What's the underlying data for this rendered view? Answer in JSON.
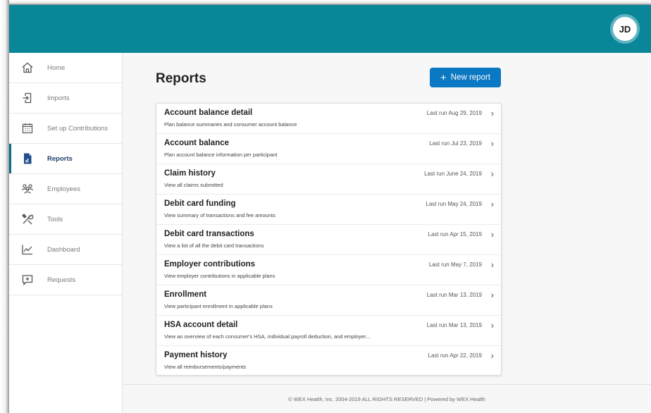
{
  "user": {
    "initials": "JD"
  },
  "sidebar": {
    "items": [
      {
        "label": "Home",
        "icon": "home-icon",
        "active": false
      },
      {
        "label": "Imports",
        "icon": "import-icon",
        "active": false
      },
      {
        "label": "Set up Contributions",
        "icon": "calendar-icon",
        "active": false
      },
      {
        "label": "Reports",
        "icon": "report-icon",
        "active": true
      },
      {
        "label": "Employees",
        "icon": "people-icon",
        "active": false
      },
      {
        "label": "Tools",
        "icon": "tools-icon",
        "active": false
      },
      {
        "label": "Dashboard",
        "icon": "chart-icon",
        "active": false
      },
      {
        "label": "Requests",
        "icon": "request-icon",
        "active": false
      }
    ]
  },
  "main": {
    "title": "Reports",
    "new_button": {
      "label": "New report",
      "icon": "plus-icon"
    }
  },
  "reports": [
    {
      "title": "Account balance detail",
      "desc": "Plan balance summaries and consumer account balance",
      "last_run": "Last run Aug 29, 2019"
    },
    {
      "title": "Account balance",
      "desc": "Plan account balance information per participant",
      "last_run": "Last run Jul 23, 2019"
    },
    {
      "title": "Claim history",
      "desc": "View all claims submitted",
      "last_run": "Last run June 24, 2019"
    },
    {
      "title": "Debit card funding",
      "desc": "View summary of transactions and fee amounts",
      "last_run": "Last run May 24, 2019"
    },
    {
      "title": "Debit card transactions",
      "desc": "View a list of all the debit card transactions",
      "last_run": "Last run Apr 15, 2019"
    },
    {
      "title": "Employer contributions",
      "desc": "View employer contributions in applicable plans",
      "last_run": "Last run May 7, 2019"
    },
    {
      "title": "Enrollment",
      "desc": "View participant enrollment in applicable plans",
      "last_run": "Last run Mar 13, 2019"
    },
    {
      "title": "HSA account detail",
      "desc": "View an overview of each consumer's HSA, individual payroll deduction, and employer...",
      "last_run": "Last run Mar 13, 2019"
    },
    {
      "title": "Payment history",
      "desc": "View all reimbursements/payments",
      "last_run": "Last run Apr 22, 2019"
    }
  ],
  "footer": {
    "text": "© WEX Health, Inc. 2004-2019 ALL RIGHTS RESERVED | Powered by WEX Health"
  },
  "colors": {
    "header": "#0a8699",
    "accent": "#0a78c2",
    "active_nav": "#1f3f6e"
  }
}
